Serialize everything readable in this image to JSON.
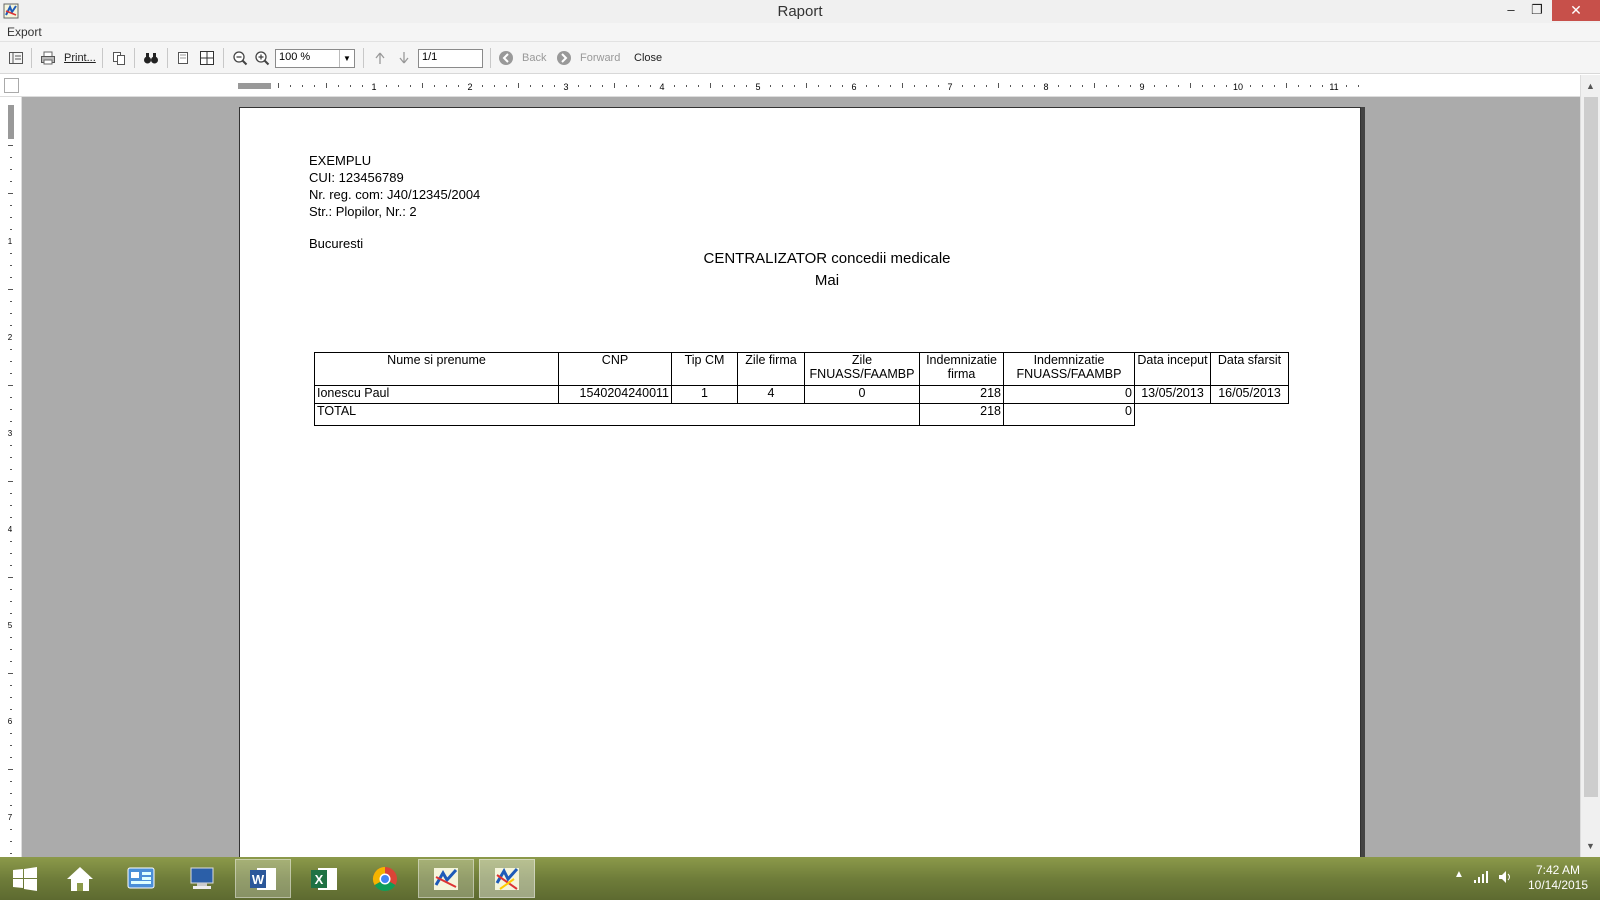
{
  "window": {
    "title": "Raport",
    "minimize_glyph": "–",
    "restore_glyph": "❐",
    "close_glyph": "✕"
  },
  "menu": {
    "export": "Export"
  },
  "toolbar": {
    "print_label": "Print...",
    "zoom_value": "100 %",
    "page_value": "1/1",
    "back_label": "Back",
    "forward_label": "Forward",
    "close_label": "Close"
  },
  "ruler": {
    "h_labels": [
      "1",
      "2",
      "3",
      "4",
      "5",
      "6",
      "7",
      "8",
      "9",
      "10",
      "11"
    ],
    "v_labels": [
      "1",
      "2",
      "3",
      "4",
      "5",
      "6",
      "7"
    ]
  },
  "report": {
    "company": [
      "EXEMPLU",
      "CUI: 123456789",
      "Nr. reg. com: J40/12345/2004",
      "Str.: Plopilor, Nr.: 2"
    ],
    "city": "Bucuresti",
    "title": "CENTRALIZATOR concedii medicale",
    "month": "Mai",
    "columns": [
      "Nume si prenume",
      "CNP",
      "Tip CM",
      "Zile firma",
      "Zile FNUASS/FAAMBP",
      "Indemnizatie firma",
      "Indemnizatie FNUASS/FAAMBP",
      "Data inceput",
      "Data sfarsit"
    ],
    "rows": [
      [
        "Ionescu Paul",
        "1540204240011",
        "1",
        "4",
        "0",
        "218",
        "0",
        "13/05/2013",
        "16/05/2013"
      ]
    ],
    "total": {
      "label": "TOTAL",
      "indemnizatie_firma": "218",
      "indemnizatie_fnuass": "0"
    }
  },
  "taskbar": {
    "time": "7:42 AM",
    "date": "10/14/2015"
  },
  "colors": {
    "window_close": "#c7504a",
    "viewport_bg": "#ababab",
    "taskbar": "#7a8840"
  }
}
